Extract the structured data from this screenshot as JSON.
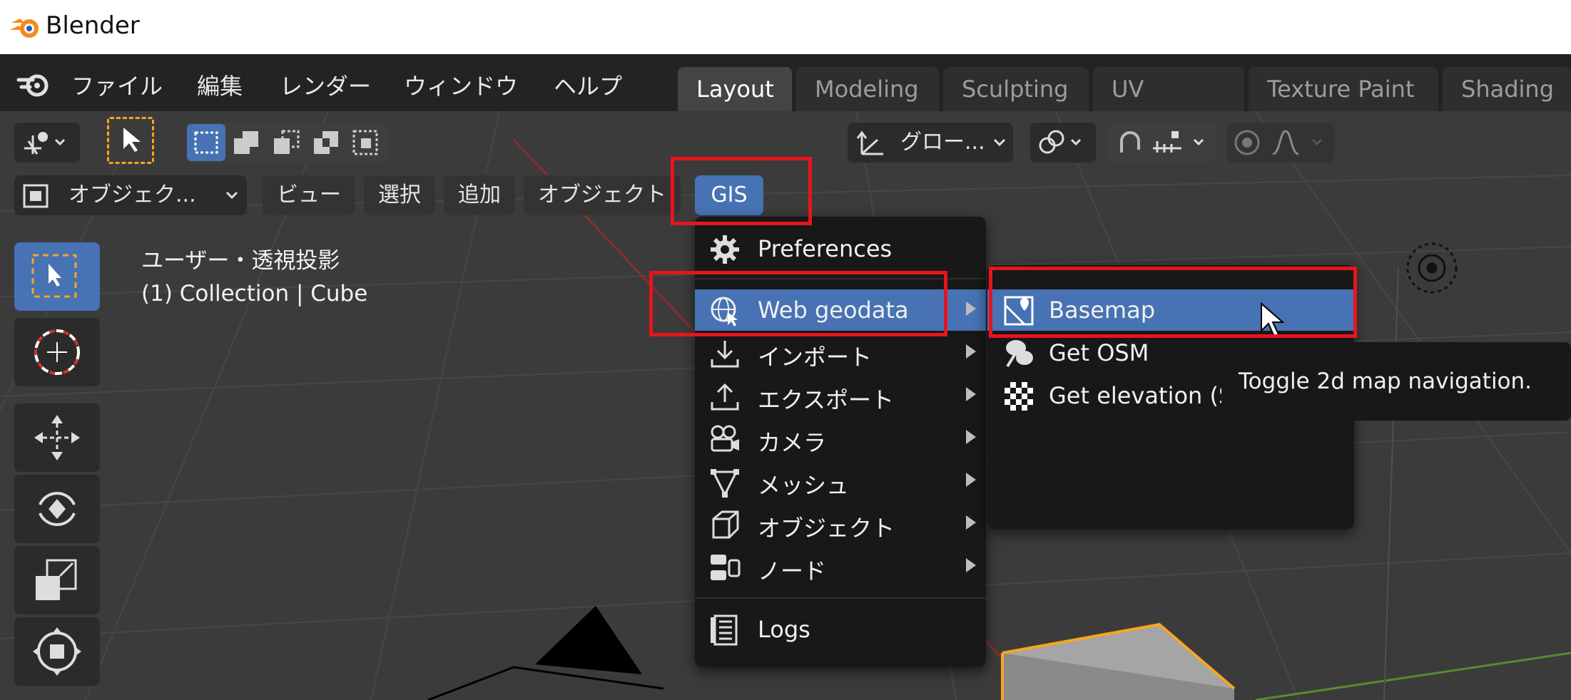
{
  "window": {
    "title": "Blender"
  },
  "menubar": {
    "items": [
      "ファイル",
      "編集",
      "レンダー",
      "ウィンドウ",
      "ヘルプ"
    ],
    "workspace_tabs": [
      {
        "label": "Layout",
        "active": true
      },
      {
        "label": "Modeling",
        "active": false
      },
      {
        "label": "Sculpting",
        "active": false
      },
      {
        "label": "UV Editing",
        "active": false
      },
      {
        "label": "Texture Paint",
        "active": false
      },
      {
        "label": "Shading",
        "active": false
      }
    ]
  },
  "tool_header": {
    "transform_orientation": "グロー...",
    "icons": [
      "tracking-icon",
      "select-cursor-icon",
      "select-box-icon",
      "select-extend-icon",
      "select-subtract-icon",
      "select-difference-icon",
      "select-intersect-icon",
      "orientation-icon",
      "pivot-icon",
      "snap-icon",
      "snap-increment-icon",
      "proportional-edit-icon",
      "falloff-icon"
    ]
  },
  "viewport_header": {
    "mode": "オブジェク...",
    "menus": [
      "ビュー",
      "選択",
      "追加",
      "オブジェクト"
    ],
    "gis_menu": "GIS"
  },
  "viewport_overlay": {
    "view_name": "ユーザー・透視投影",
    "collection_info": "(1) Collection | Cube"
  },
  "gis_menu": {
    "items": [
      {
        "label": "Preferences",
        "icon": "gear-icon",
        "submenu": false
      },
      {
        "label": "Web geodata",
        "icon": "globe-cursor-icon",
        "submenu": true,
        "highlighted": true
      },
      {
        "label": "インポート",
        "icon": "import-icon",
        "submenu": true
      },
      {
        "label": "エクスポート",
        "icon": "export-icon",
        "submenu": true
      },
      {
        "label": "カメラ",
        "icon": "camera-icon",
        "submenu": true
      },
      {
        "label": "メッシュ",
        "icon": "mesh-icon",
        "submenu": true
      },
      {
        "label": "オブジェクト",
        "icon": "cube-icon",
        "submenu": true
      },
      {
        "label": "ノード",
        "icon": "node-icon",
        "submenu": true
      },
      {
        "label": "Logs",
        "icon": "logs-icon",
        "submenu": false
      }
    ]
  },
  "web_geodata_submenu": {
    "items": [
      {
        "label": "Basemap",
        "icon": "basemap-icon",
        "highlighted": true
      },
      {
        "label": "Get OSM",
        "icon": "osm-icon"
      },
      {
        "label": "Get elevation (SRTM)",
        "icon": "checker-icon"
      }
    ]
  },
  "tooltip": {
    "text": "Toggle 2d map navigation."
  },
  "colors": {
    "accent_blue": "#4772b3",
    "highlight_red": "#e8141c",
    "selection_orange": "#f5a623"
  }
}
